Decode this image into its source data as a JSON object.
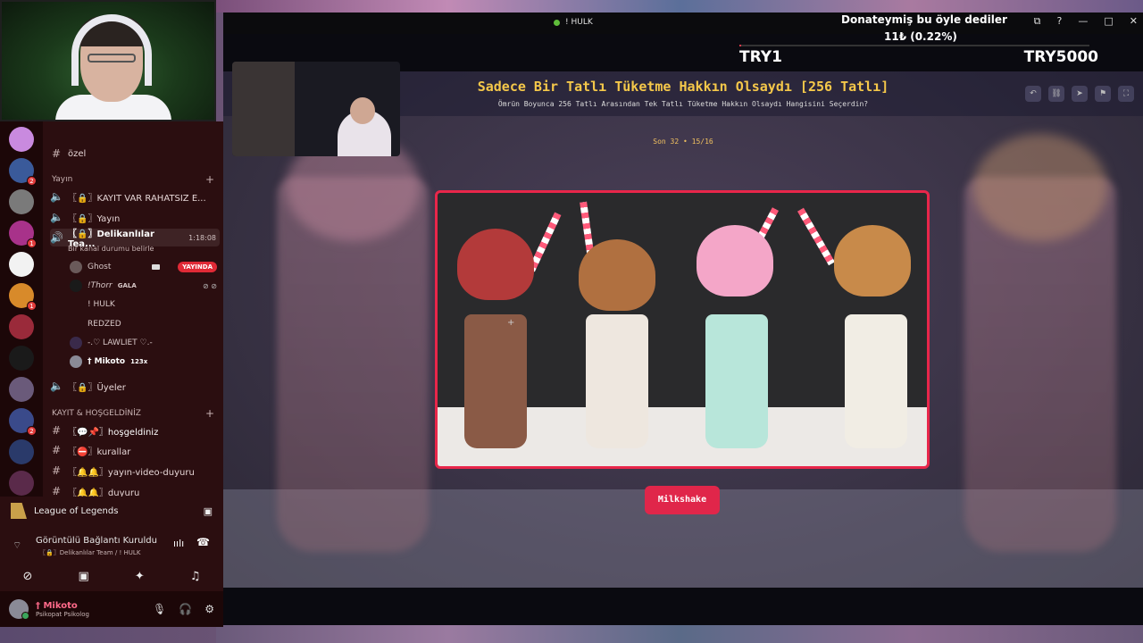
{
  "stream": {
    "title_bar": "! HULK",
    "donation": {
      "title": "Donateymiş bu öyle dediler",
      "amount": "11₺ (0.22%)",
      "progress_fraction": 0.0022,
      "min_label": "TRY1",
      "max_label": "TRY5000"
    }
  },
  "game": {
    "title": "Sadece Bir Tatlı Tüketme Hakkın Olsaydı [256 Tatlı]",
    "subtitle": "Ömrün Boyunca 256 Tatlı Arasından Tek Tatlı Tüketme Hakkın Olsaydı Hangisini Seçerdin?",
    "round": "Son 32 • 15/16",
    "choice_label": "Milkshake",
    "scroll_up": "^"
  },
  "discord": {
    "channels": {
      "ozel": "özel",
      "section_yayin": "Yayın",
      "kayit_var": "〖🔒〗KAYIT VAR RAHATSIZ E...",
      "yayin": "〖🔒〗Yayın",
      "delikanlilar": "〖🔒〗Delikanlılar Tea...",
      "delikanlilar_time": "1:18:08",
      "status_note": "Bir kanal durumu belirle",
      "uyeler": "〖🔒〗Üyeler",
      "section_kayit": "KAYIT & HOŞGELDİNİZ",
      "hosgeldiniz": "〖💬📌〗hoşgeldiniz",
      "kurallar": "〖⛔〗kurallar",
      "yayin_video": "〖🔔🔔〗yayın-video-duyuru",
      "duyuru": "〖🔔🔔〗duyuru"
    },
    "members": {
      "ghost": "Ghost",
      "live": "YAYINDA",
      "thorr": "!Thorr",
      "thorr_tag": "GALA",
      "hulk": "! HULK",
      "redzed": "REDZED",
      "lawliet": "-.♡ LAWLIET ♡.-",
      "mikoto": "† Mikoto",
      "mikoto_tag": "123x"
    },
    "activity": "League of Legends",
    "voice_title": "Görüntülü Bağlantı Kuruldu",
    "voice_sub": "〖🔒〗Delikanlılar Team / ! HULK",
    "user_name": "† Mikoto",
    "user_status": "Psikopat Psikolog"
  },
  "colors": {
    "accent": "#e0264a",
    "title_gold": "#f5c84a",
    "discord_bg": "#2b0e10"
  }
}
